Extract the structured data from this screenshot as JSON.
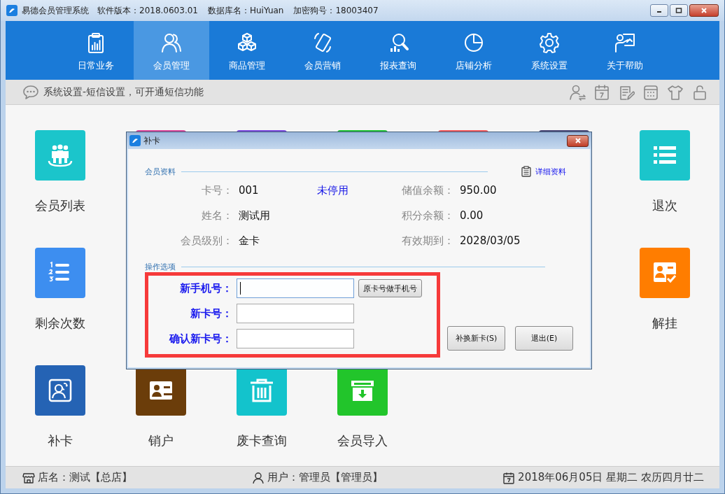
{
  "window": {
    "title": "易德会员管理系统",
    "version": "软件版本：2018.0603.01",
    "database": "数据库名：HuiYuan",
    "dongle": "加密狗号：18003407"
  },
  "nav": [
    {
      "label": "日常业务",
      "selected": false
    },
    {
      "label": "会员管理",
      "selected": true
    },
    {
      "label": "商品管理",
      "selected": false
    },
    {
      "label": "会员营销",
      "selected": false
    },
    {
      "label": "报表查询",
      "selected": false
    },
    {
      "label": "店铺分析",
      "selected": false
    },
    {
      "label": "系统设置",
      "selected": false
    },
    {
      "label": "关于帮助",
      "selected": false
    }
  ],
  "toolbar": {
    "message": "系统设置-短信设置，可开通短信功能"
  },
  "tile_rows": [
    [
      {
        "label": "会员列表",
        "color": "#1bc5cb"
      },
      {
        "color": "#d8479b"
      },
      {
        "color": "#7a48dc"
      },
      {
        "color": "#20c136"
      },
      {
        "color": "#f05a5e"
      },
      {
        "color": "#4b4978"
      }
    ],
    [
      {
        "label": "剩余次数",
        "color": "#3d8ef0"
      }
    ],
    [
      {
        "label": "补卡",
        "color": "#2563b4"
      },
      {
        "label": "销户",
        "color": "#6b3d0a"
      },
      {
        "label": "废卡查询",
        "color": "#13c3cc"
      },
      {
        "label": "会员导入",
        "color": "#22c52b"
      }
    ]
  ],
  "tiles_right": [
    {
      "label": "退次",
      "color": "#1bc5cb"
    },
    {
      "label": "解挂",
      "color": "#ff7d00"
    }
  ],
  "dialog": {
    "title": "补卡",
    "section1": "会员资料",
    "detail_link": "详细资料",
    "fields_left": [
      {
        "label": "卡号：",
        "value": "001"
      },
      {
        "label": "姓名：",
        "value": "测试用"
      },
      {
        "label": "会员级别：",
        "value": "金卡"
      }
    ],
    "status": "未停用",
    "fields_right": [
      {
        "label": "储值余额：",
        "value": "950.00"
      },
      {
        "label": "积分余额：",
        "value": "0.00"
      },
      {
        "label": "有效期到：",
        "value": "2028/03/05"
      }
    ],
    "section2": "操作选项",
    "inputs": [
      {
        "label": "新手机号：",
        "focused": true
      },
      {
        "label": "新卡号：",
        "focused": false
      },
      {
        "label": "确认新卡号：",
        "focused": false
      }
    ],
    "copy_button": "原卡号做手机号",
    "actions": [
      "补换新卡(S)",
      "退出(E)"
    ]
  },
  "status_bar": {
    "store": "店名：测试【总店】",
    "user": "用户：管理员【管理员】",
    "date": "2018年06月05日 星期二 农历四月廿二"
  }
}
